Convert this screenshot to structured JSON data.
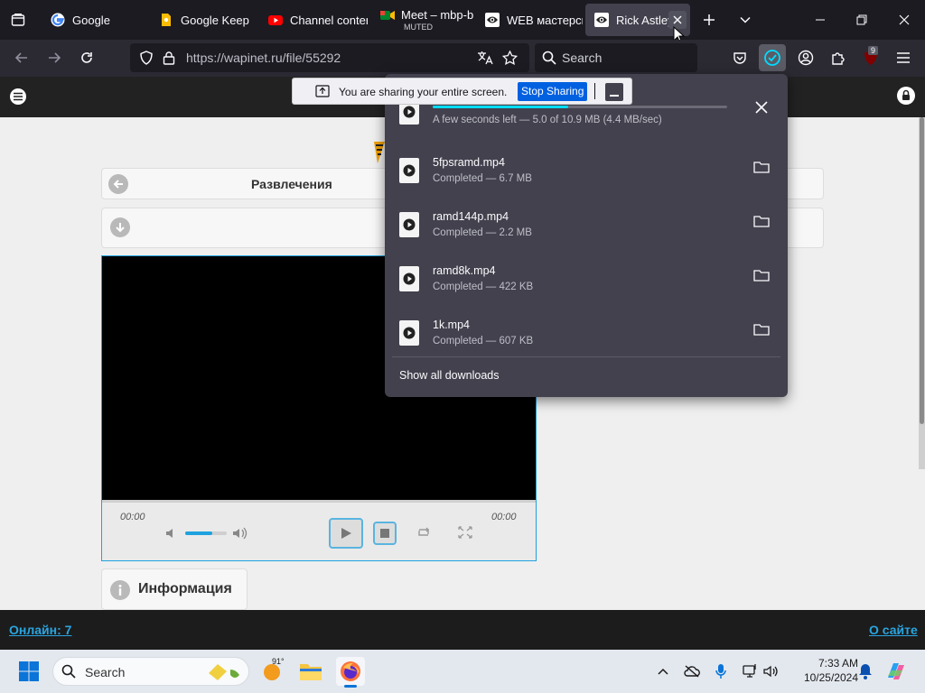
{
  "browser": {
    "tabs": [
      {
        "title": "Google",
        "icon": "google-favicon"
      },
      {
        "title": "Google Keep",
        "icon": "keep-favicon"
      },
      {
        "title": "Channel content",
        "icon": "youtube-favicon"
      },
      {
        "title": "Meet – mbp-b",
        "subtitle": "MUTED",
        "icon": "meet-favicon"
      },
      {
        "title": "WEB мастерская",
        "icon": "eye-favicon"
      },
      {
        "title": "Rick Astley",
        "icon": "eye-favicon",
        "active": true
      }
    ],
    "url": "https://wapinet.ru/file/55292",
    "search_placeholder": "Search",
    "extension_badge": "9"
  },
  "share_bar": {
    "message": "You are sharing your entire screen.",
    "stop_label": "Stop Sharing"
  },
  "downloads": {
    "in_progress": {
      "status": "A few seconds left — 5.0 of 10.9 MB (4.4 MB/sec)",
      "progress": 0.46
    },
    "items": [
      {
        "name": "5fpsramd.mp4",
        "status": "Completed — 6.7 MB"
      },
      {
        "name": "ramd144p.mp4",
        "status": "Completed — 2.2 MB"
      },
      {
        "name": "ramd8k.mp4",
        "status": "Completed — 422 KB"
      },
      {
        "name": "1k.mp4",
        "status": "Completed — 607 KB"
      }
    ],
    "show_all_label": "Show all downloads"
  },
  "page": {
    "category_label": "Развлечения",
    "player": {
      "time_current": "00:00",
      "time_total": "00:00",
      "volume": 0.65
    },
    "info_label": "Информация",
    "footer": {
      "online_label": "Онлайн: 7",
      "about_label": "О сайте"
    }
  },
  "taskbar": {
    "search_placeholder": "Search",
    "weather_temp": "91°",
    "time": "7:33 AM",
    "date": "10/25/2024"
  },
  "colors": {
    "accent": "#00ddff",
    "share_button": "#0061e0",
    "site_link": "#2aa5e0",
    "player_border": "#1fa2df"
  }
}
